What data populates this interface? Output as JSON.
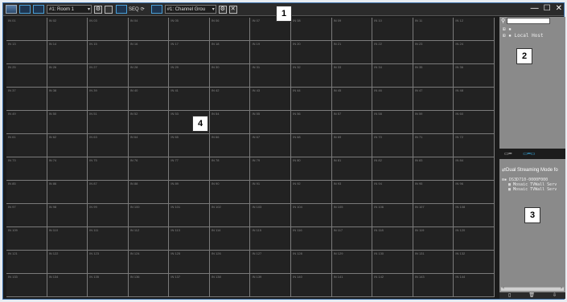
{
  "toolbar": {
    "room_combo": "#1: Room 1",
    "channel_combo": "#1: Channel Grou",
    "seq_label": "SEQ",
    "min_label": "—",
    "max_label": "☐",
    "close_label": "✕"
  },
  "grid": {
    "cells": [
      "IN 01",
      "IN 02",
      "IN 03",
      "IN 04",
      "IN 05",
      "IN 06",
      "IN 07",
      "IN 08",
      "IN 09",
      "IN 10",
      "IN 11",
      "IN 12",
      "IN 13",
      "IN 14",
      "IN 15",
      "IN 16",
      "IN 17",
      "IN 18",
      "IN 19",
      "IN 20",
      "IN 21",
      "IN 22",
      "IN 23",
      "IN 24",
      "IN 25",
      "IN 26",
      "IN 27",
      "IN 28",
      "IN 29",
      "IN 30",
      "IN 31",
      "IN 32",
      "IN 33",
      "IN 34",
      "IN 35",
      "IN 36",
      "IN 37",
      "IN 38",
      "IN 39",
      "IN 40",
      "IN 41",
      "IN 42",
      "IN 43",
      "IN 44",
      "IN 45",
      "IN 46",
      "IN 47",
      "IN 48",
      "IN 49",
      "IN 50",
      "IN 51",
      "IN 52",
      "IN 53",
      "IN 54",
      "IN 55",
      "IN 56",
      "IN 57",
      "IN 58",
      "IN 59",
      "IN 60",
      "IN 61",
      "IN 62",
      "IN 63",
      "IN 64",
      "IN 65",
      "IN 66",
      "IN 67",
      "IN 68",
      "IN 69",
      "IN 70",
      "IN 71",
      "IN 72",
      "IN 73",
      "IN 74",
      "IN 75",
      "IN 76",
      "IN 77",
      "IN 78",
      "IN 79",
      "IN 80",
      "IN 81",
      "IN 82",
      "IN 83",
      "IN 84",
      "IN 85",
      "IN 86",
      "IN 87",
      "IN 88",
      "IN 89",
      "IN 90",
      "IN 91",
      "IN 92",
      "IN 93",
      "IN 94",
      "IN 95",
      "IN 96",
      "IN 97",
      "IN 98",
      "IN 99",
      "IN 100",
      "IN 101",
      "IN 102",
      "IN 103",
      "IN 104",
      "IN 105",
      "IN 106",
      "IN 107",
      "IN 108",
      "IN 109",
      "IN 110",
      "IN 111",
      "IN 112",
      "IN 113",
      "IN 114",
      "IN 115",
      "IN 116",
      "IN 117",
      "IN 118",
      "IN 119",
      "IN 120",
      "IN 121",
      "IN 122",
      "IN 123",
      "IN 124",
      "IN 125",
      "IN 126",
      "IN 127",
      "IN 128",
      "IN 129",
      "IN 130",
      "IN 131",
      "IN 132",
      "IN 133",
      "IN 134",
      "IN 135",
      "IN 136",
      "IN 137",
      "IN 138",
      "IN 139",
      "IN 140",
      "IN 141",
      "IN 142",
      "IN 143",
      "IN 144"
    ]
  },
  "panel": {
    "tree_root": "Local Host",
    "mode_title": "Dual Streaming Mode fo",
    "device": "DS3D710-0000F000",
    "items": [
      "Mosaic TVWall Serv",
      "Mosaic TVWall Serv"
    ]
  },
  "callouts": [
    "1",
    "2",
    "3",
    "4"
  ]
}
